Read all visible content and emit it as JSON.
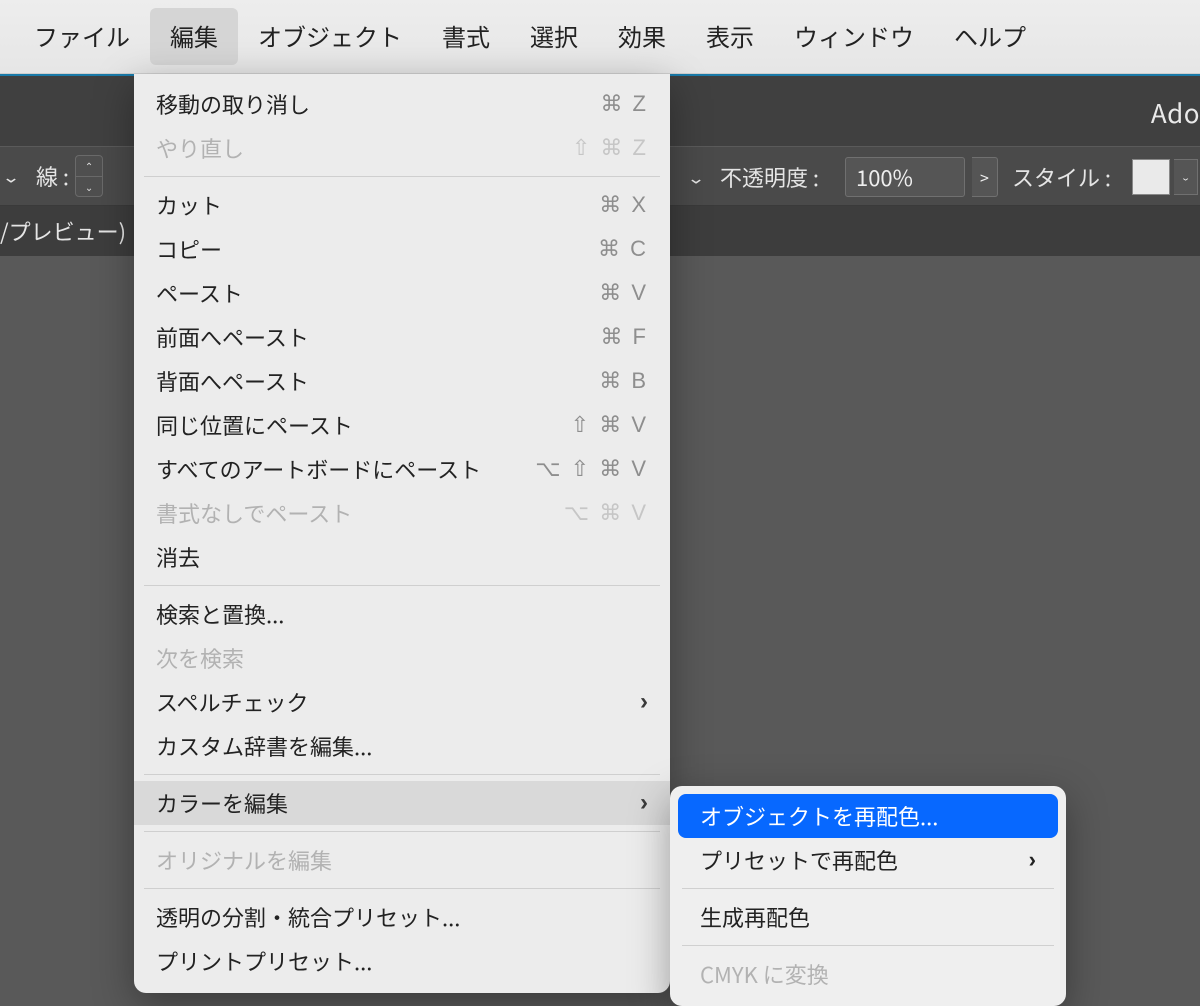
{
  "menubar": {
    "items": [
      "ファイル",
      "編集",
      "オブジェクト",
      "書式",
      "選択",
      "効果",
      "表示",
      "ウィンドウ",
      "ヘルプ"
    ],
    "active_index": 1
  },
  "app_label_fragment": "Ado",
  "option_bar": {
    "stroke_label": "線 :",
    "opacity_label": "不透明度 :",
    "opacity_value": "100%",
    "style_label": "スタイル :"
  },
  "document_tab": "/プレビュー)",
  "edit_menu": {
    "groups": [
      [
        {
          "label": "移動の取り消し",
          "shortcut": "⌘ Z"
        },
        {
          "label": "やり直し",
          "shortcut": "⇧ ⌘ Z",
          "disabled": true
        }
      ],
      [
        {
          "label": "カット",
          "shortcut": "⌘ X"
        },
        {
          "label": "コピー",
          "shortcut": "⌘ C"
        },
        {
          "label": "ペースト",
          "shortcut": "⌘ V"
        },
        {
          "label": "前面へペースト",
          "shortcut": "⌘ F"
        },
        {
          "label": "背面へペースト",
          "shortcut": "⌘ B"
        },
        {
          "label": "同じ位置にペースト",
          "shortcut": "⇧ ⌘ V"
        },
        {
          "label": "すべてのアートボードにペースト",
          "shortcut": "⌥ ⇧ ⌘ V"
        },
        {
          "label": "書式なしでペースト",
          "shortcut": "⌥ ⌘ V",
          "disabled": true
        },
        {
          "label": "消去"
        }
      ],
      [
        {
          "label": "検索と置換..."
        },
        {
          "label": "次を検索",
          "disabled": true
        },
        {
          "label": "スペルチェック",
          "submenu": true
        },
        {
          "label": "カスタム辞書を編集..."
        }
      ],
      [
        {
          "label": "カラーを編集",
          "submenu": true,
          "hover": true
        }
      ],
      [
        {
          "label": "オリジナルを編集",
          "disabled": true
        }
      ],
      [
        {
          "label": "透明の分割・統合プリセット..."
        },
        {
          "label": "プリントプリセット..."
        }
      ]
    ]
  },
  "color_submenu": {
    "items": [
      {
        "label": "オブジェクトを再配色...",
        "selected": true
      },
      {
        "label": "プリセットで再配色",
        "submenu": true
      },
      {
        "sep": true
      },
      {
        "label": "生成再配色"
      },
      {
        "sep": true
      },
      {
        "label": "CMYK に変換",
        "disabled": true
      }
    ]
  }
}
